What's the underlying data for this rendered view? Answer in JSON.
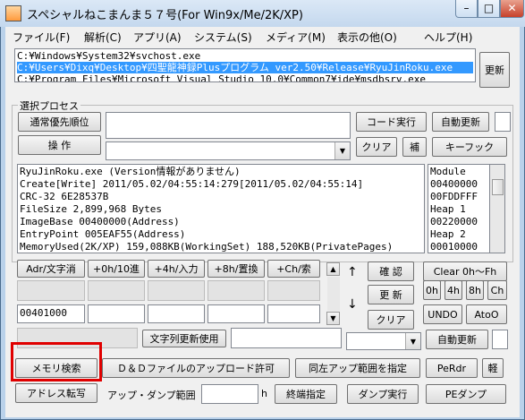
{
  "window": {
    "title": "スペシャルねこまんま５７号(For Win9x/Me/2K/XP)"
  },
  "menu": [
    "ファイル(F)",
    "解析(C)",
    "アプリ(A)",
    "システム(S)",
    "メディア(M)",
    "表示の他(O)",
    "ヘルプ(H)"
  ],
  "process_list": {
    "rows": [
      "C:¥Windows¥System32¥svchost.exe",
      "C:¥Users¥Dixq¥Desktop¥四聖龍神録Plusプログラム ver2.50¥Release¥RyuJinRoku.exe",
      "C:¥Program Files¥Microsoft Visual Studio 10.0¥Common7¥ide¥msdbsrv.exe"
    ],
    "selected_index": 1
  },
  "buttons": {
    "update_top": "更新",
    "normal_priority": "通常優先順位",
    "operate": "操 作",
    "code_exec": "コード実行",
    "auto_update_1": "自動更新",
    "clear_1": "クリア",
    "supplement": "補",
    "key_hook": "キーフック",
    "adr_char": "Adr/文字消",
    "h0_10": "+0h/10進",
    "h4_input": "+4h/入力",
    "h8_replace": "+8h/置換",
    "hc_search": "+Ch/索",
    "confirm": "確 認",
    "clear_range": "Clear 0h〜Fh",
    "update_mid": "更 新",
    "h0": "0h",
    "h4": "4h",
    "h8": "8h",
    "ch": "Ch",
    "clear_2": "クリア",
    "undo": "UNDO",
    "ato0": "AtoO",
    "str_update": "文字列更新使用",
    "auto_update_2": "自動更新",
    "memory_search": "メモリ検索",
    "dd_upload": "Ｄ＆Ｄファイルのアップロード許可",
    "left_up_range": "同左アップ範囲を指定",
    "perdr": "PeRdr",
    "kan": "軽",
    "address_transfer": "アドレス転写",
    "end_specify": "終端指定",
    "dump_exec": "ダンプ実行",
    "pe_dump": "PEダンプ"
  },
  "labels": {
    "select_process": "選択プロセス",
    "up_dump_range": "アップ・ダンプ範囲",
    "h_suffix": "h"
  },
  "info_lines": [
    "RyuJinRoku.exe (Version情報がありません)",
    "Create[Write] 2011/05.02/04:55:14:279[2011/05.02/04:55:14]",
    "CRC-32       6E28537B",
    "FileSize     2,899,968 Bytes",
    "ImageBase    00400000(Address)",
    "EntryPoint   005EAF55(Address)",
    "MemoryUsed(2K/XP) 159,088KB(WorkingSet) 188,520KB(PrivatePages)"
  ],
  "module_list": [
    "Module",
    "00400000",
    "00FDDFFF",
    "Heap 1",
    "00220000",
    "Heap 2",
    "00010000"
  ],
  "address_field": "00401000",
  "colors": {
    "highlight": "#e00000",
    "selection": "#3399ff"
  }
}
